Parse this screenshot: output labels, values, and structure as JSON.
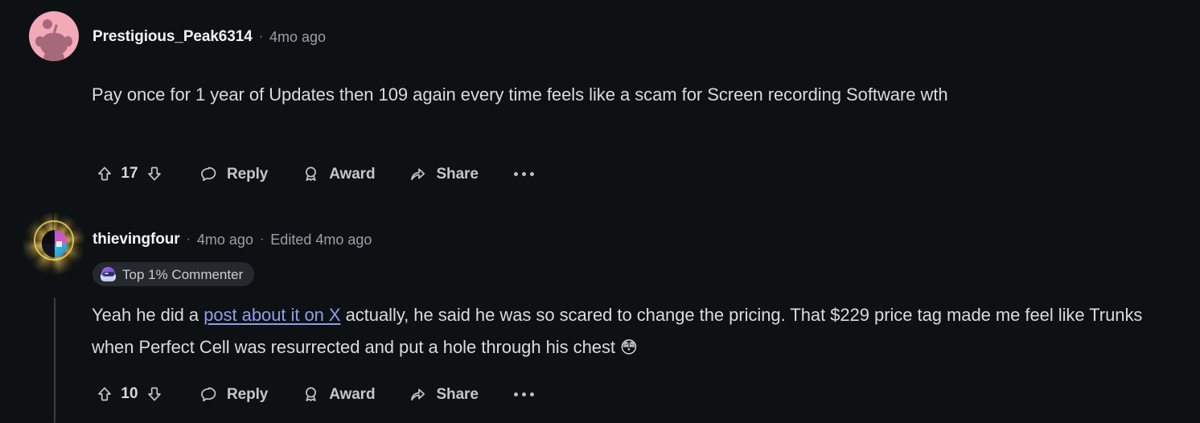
{
  "theme": {
    "background": "#0e1113",
    "text_primary": "#d9dcdf",
    "text_muted": "#9aa0a6",
    "link": "#8aa0e8",
    "badge_bg": "#25282c",
    "thread_line": "#3a3f43"
  },
  "comments": [
    {
      "id": "root",
      "author": "Prestigious_Peak6314",
      "separator": "·",
      "timestamp": "4mo ago",
      "edited": null,
      "badge": null,
      "avatar_icon": "snoo-avatar",
      "body_before_link": "Pay once for 1 year of Updates then 109 again every time feels like a scam for Screen recording Software wth",
      "link_text": null,
      "body_after_link": null,
      "emoji": null,
      "actions": {
        "upvote_icon": "upvote-arrow-icon",
        "score": "17",
        "downvote_icon": "downvote-arrow-icon",
        "reply_label": "Reply",
        "reply_icon": "comment-bubble-icon",
        "award_label": "Award",
        "award_icon": "award-ribbon-icon",
        "share_label": "Share",
        "share_icon": "share-arrow-icon",
        "overflow_icon": "more-options-icon"
      }
    },
    {
      "id": "reply",
      "author": "thievingfour",
      "separator": "·",
      "timestamp": "4mo ago",
      "edited": "Edited 4mo ago",
      "badge": {
        "label": "Top 1% Commenter",
        "icon": "top-commenter-icon"
      },
      "avatar_icon": "glowing-nft-avatar",
      "body_before_link": "Yeah he did a ",
      "link_text": "post about it on X",
      "body_after_link": " actually, he said he was so scared to change the pricing. That $229 price tag made me feel like Trunks when Perfect Cell was resurrected and put a hole through his chest ",
      "emoji": "😳",
      "actions": {
        "upvote_icon": "upvote-arrow-icon",
        "score": "10",
        "downvote_icon": "downvote-arrow-icon",
        "reply_label": "Reply",
        "reply_icon": "comment-bubble-icon",
        "award_label": "Award",
        "award_icon": "award-ribbon-icon",
        "share_label": "Share",
        "share_icon": "share-arrow-icon",
        "overflow_icon": "more-options-icon"
      }
    }
  ]
}
